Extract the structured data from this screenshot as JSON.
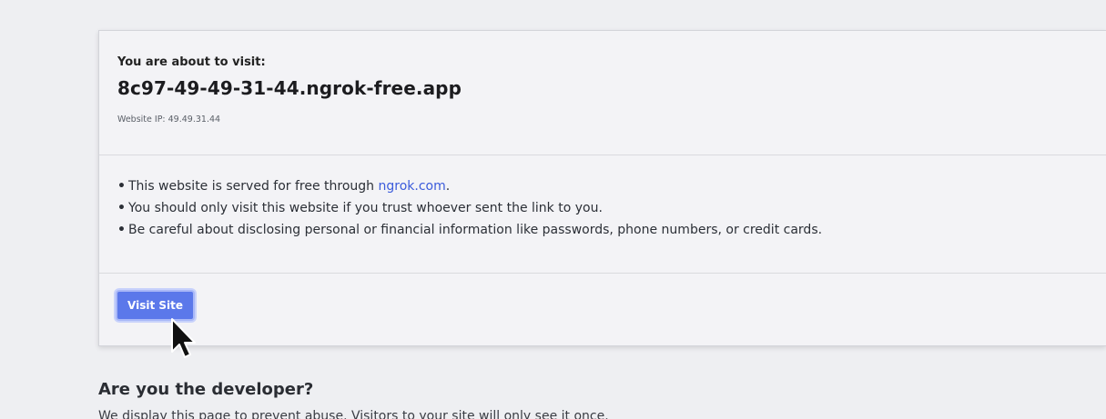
{
  "card": {
    "about_label": "You are about to visit:",
    "hostname": "8c97-49-49-31-44.ngrok-free.app",
    "website_ip": "Website IP: 49.49.31.44",
    "bullets": [
      {
        "text_before": "This website is served for free through ",
        "link": "ngrok.com",
        "text_after": "."
      },
      {
        "text": "You should only visit this website if you trust whoever sent the link to you."
      },
      {
        "text": "Be careful about disclosing personal or financial information like passwords, phone numbers, or credit cards."
      }
    ],
    "visit_button": "Visit Site"
  },
  "developer": {
    "title": "Are you the developer?",
    "text_partial": "We display this page to prevent abuse. Visitors to your site will only see it once."
  },
  "colors": {
    "accent": "#5b78ea",
    "link": "#3b5bdb",
    "background": "#eeeff2"
  },
  "icons": {
    "cursor": "mouse-pointer-icon"
  }
}
